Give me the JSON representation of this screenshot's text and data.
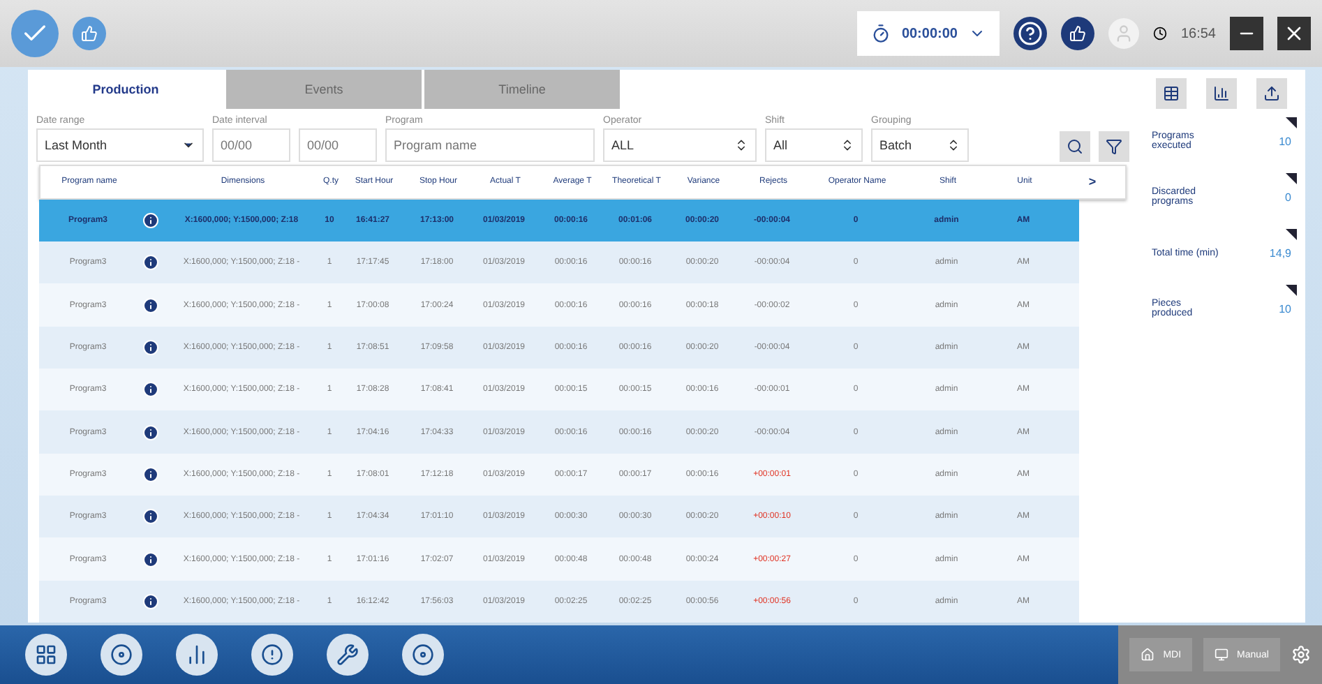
{
  "top_bar": {
    "timer": "00:00:00",
    "clock": "16:54"
  },
  "tabs": [
    {
      "label": "Production",
      "selected": true
    },
    {
      "label": "Events",
      "selected": false
    },
    {
      "label": "Timeline",
      "selected": false
    }
  ],
  "filters": [
    {
      "label": "Date range",
      "kind": "dropdown",
      "value": "Last Month"
    },
    {
      "label": "Date interval",
      "kind": "date",
      "placeholder": "00/00"
    },
    {
      "kind": "date",
      "placeholder": "00/00"
    },
    {
      "label": "Program",
      "kind": "text",
      "placeholder": "Program name"
    },
    {
      "label": "Operator",
      "kind": "spinner",
      "value": "ALL"
    },
    {
      "label": "Shift",
      "kind": "spinner",
      "value": "All"
    },
    {
      "label": "Grouping",
      "kind": "spinner",
      "value": "Batch"
    }
  ],
  "table": {
    "columns": [
      "Program name",
      "Dimensions",
      "Q.ty",
      "Start Hour",
      "Stop Hour",
      "Actual T",
      "Average T",
      "Theoretical T",
      "Variance",
      "Rejects",
      "Operator Name",
      "Shift",
      "Unit"
    ],
    "more": ">",
    "rows": [
      {
        "selected": true,
        "over": false,
        "cells": [
          "Program3",
          "X:1600,000; Y:1500,000; Z:18",
          "10",
          "16:41:27",
          "17:13:00",
          "01/03/2019",
          "00:00:16",
          "00:01:06",
          "00:00:20",
          "-00:00:04",
          "0",
          "admin",
          "AM"
        ]
      },
      {
        "selected": false,
        "over": false,
        "cells": [
          "Program3",
          "X:1600,000; Y:1500,000; Z:18 -",
          "1",
          "17:17:45",
          "17:18:00",
          "01/03/2019",
          "00:00:16",
          "00:00:16",
          "00:00:20",
          "-00:00:04",
          "0",
          "admin",
          "AM"
        ]
      },
      {
        "selected": false,
        "over": false,
        "cells": [
          "Program3",
          "X:1600,000; Y:1500,000; Z:18 -",
          "1",
          "17:00:08",
          "17:00:24",
          "01/03/2019",
          "00:00:16",
          "00:00:16",
          "00:00:18",
          "-00:00:02",
          "0",
          "admin",
          "AM"
        ]
      },
      {
        "selected": false,
        "over": false,
        "cells": [
          "Program3",
          "X:1600,000; Y:1500,000; Z:18 -",
          "1",
          "17:08:51",
          "17:09:58",
          "01/03/2019",
          "00:00:16",
          "00:00:16",
          "00:00:20",
          "-00:00:04",
          "0",
          "admin",
          "AM"
        ]
      },
      {
        "selected": false,
        "over": false,
        "cells": [
          "Program3",
          "X:1600,000; Y:1500,000; Z:18 -",
          "1",
          "17:08:28",
          "17:08:41",
          "01/03/2019",
          "00:00:15",
          "00:00:15",
          "00:00:16",
          "-00:00:01",
          "0",
          "admin",
          "AM"
        ]
      },
      {
        "selected": false,
        "over": false,
        "cells": [
          "Program3",
          "X:1600,000; Y:1500,000; Z:18 -",
          "1",
          "17:04:16",
          "17:04:33",
          "01/03/2019",
          "00:00:16",
          "00:00:16",
          "00:00:20",
          "-00:00:04",
          "0",
          "admin",
          "AM"
        ]
      },
      {
        "selected": false,
        "over": true,
        "cells": [
          "Program3",
          "X:1600,000; Y:1500,000; Z:18 -",
          "1",
          "17:08:01",
          "17:12:18",
          "01/03/2019",
          "00:00:17",
          "00:00:17",
          "00:00:16",
          "+00:00:01",
          "0",
          "admin",
          "AM"
        ]
      },
      {
        "selected": false,
        "over": true,
        "cells": [
          "Program3",
          "X:1600,000; Y:1500,000; Z:18 -",
          "1",
          "17:04:34",
          "17:01:10",
          "01/03/2019",
          "00:00:30",
          "00:00:30",
          "00:00:20",
          "+00:00:10",
          "0",
          "admin",
          "AM"
        ]
      },
      {
        "selected": false,
        "over": true,
        "cells": [
          "Program3",
          "X:1600,000; Y:1500,000; Z:18 -",
          "1",
          "17:01:16",
          "17:02:07",
          "01/03/2019",
          "00:00:48",
          "00:00:48",
          "00:00:24",
          "+00:00:27",
          "0",
          "admin",
          "AM"
        ]
      },
      {
        "selected": false,
        "over": true,
        "cells": [
          "Program3",
          "X:1600,000; Y:1500,000; Z:18 -",
          "1",
          "16:12:42",
          "17:56:03",
          "01/03/2019",
          "00:02:25",
          "00:02:25",
          "00:00:56",
          "+00:00:56",
          "0",
          "admin",
          "AM"
        ]
      }
    ]
  },
  "stats": [
    {
      "label": "Programs executed",
      "value": "10"
    },
    {
      "label": "Discarded programs",
      "value": "0"
    },
    {
      "label": "Total time (min)",
      "value": "14,9"
    },
    {
      "label": "Pieces produced",
      "value": "10"
    }
  ],
  "status": {
    "mode_1": "MDI",
    "mode_2": "Manual"
  }
}
